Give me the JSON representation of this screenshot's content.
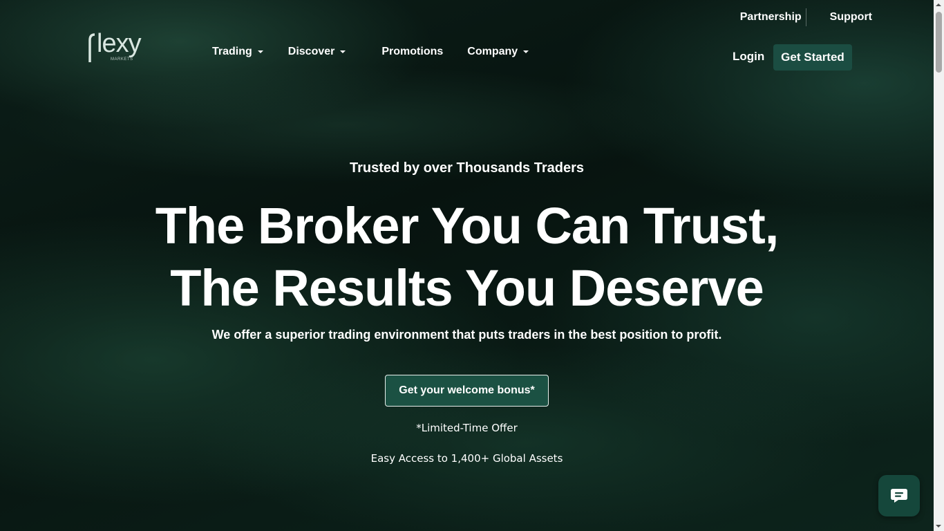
{
  "topbar": {
    "partnership": "Partnership",
    "support": "Support"
  },
  "logo": {
    "name": "lexy",
    "sub": "MARKETS"
  },
  "nav": {
    "items": [
      {
        "label": "Trading",
        "has_dropdown": true
      },
      {
        "label": "Discover",
        "has_dropdown": true
      },
      {
        "label": "Promotions",
        "has_dropdown": false
      },
      {
        "label": "Company",
        "has_dropdown": true
      }
    ]
  },
  "auth": {
    "login": "Login",
    "get_started": "Get Started"
  },
  "hero": {
    "trusted": "Trusted by over Thousands Traders",
    "headline_line1": "The Broker You Can Trust,",
    "headline_line2": "The Results You Deserve",
    "subtext": "We offer a superior trading environment that puts traders in the best position to profit.",
    "bonus_button": "Get your welcome bonus*",
    "offer": "*Limited-Time Offer",
    "access": "Easy Access to 1,400+ Global Assets"
  },
  "chat": {
    "icon": "chat-bubble-icon"
  },
  "colors": {
    "accent": "#1b4d42",
    "background": "#06100d"
  }
}
